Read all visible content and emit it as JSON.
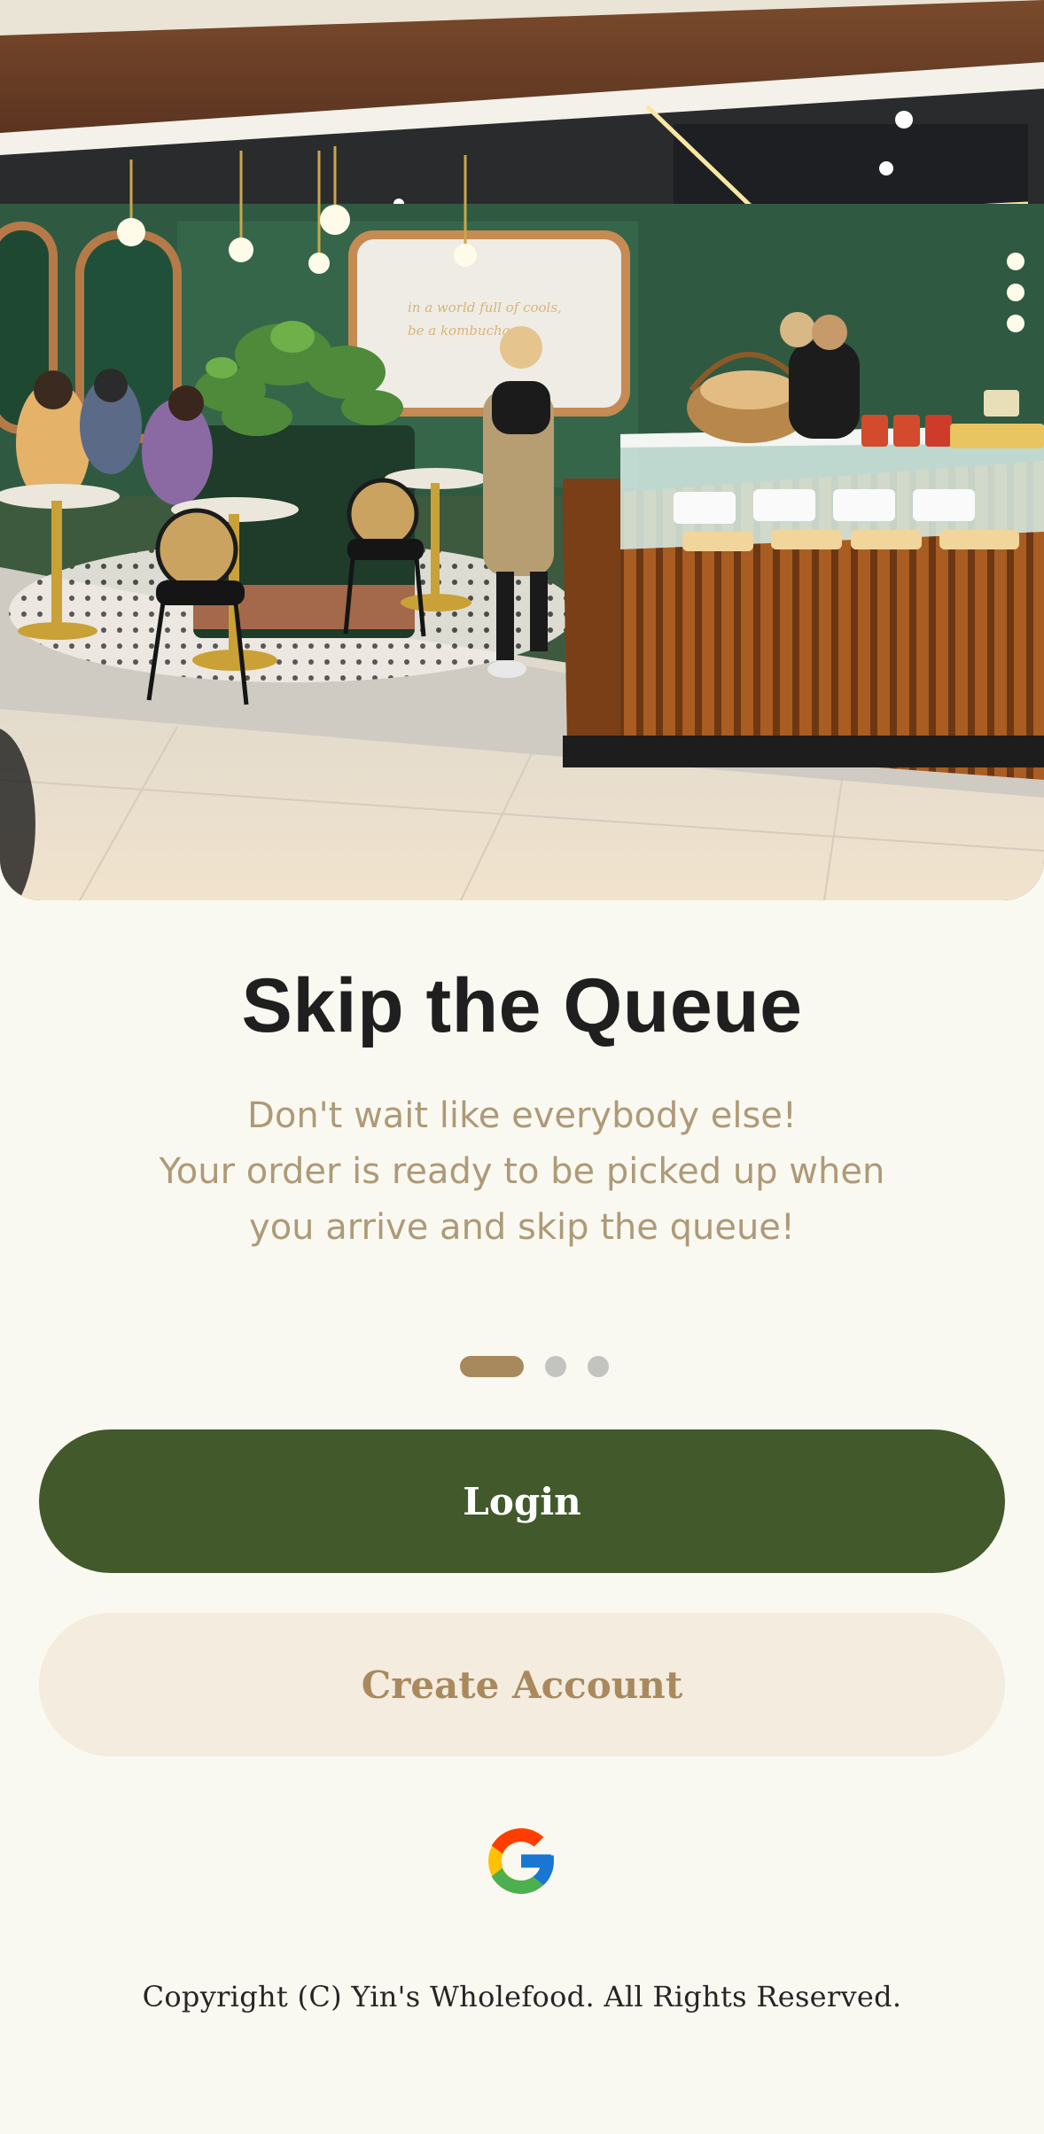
{
  "onboarding": {
    "title": "Skip the Queue",
    "subtitle_lines": [
      "Don't wait like everybody else!",
      "Your order is ready to be picked up when",
      "you arrive and skip the queue!"
    ],
    "page_indicator": {
      "total": 3,
      "active": 1
    }
  },
  "actions": {
    "login_label": "Login",
    "create_account_label": "Create Account",
    "google_icon": "google-icon"
  },
  "footer": {
    "copyright": "Copyright (C) Yin's Wholefood. All Rights Reserved."
  },
  "colors": {
    "background": "#faf9f1",
    "primary_green": "#41592b",
    "accent_tan": "#a8895d",
    "secondary_bg": "#f3ecdf",
    "subtitle_text": "#ae9a78",
    "dot_inactive": "#c3c3bf"
  }
}
